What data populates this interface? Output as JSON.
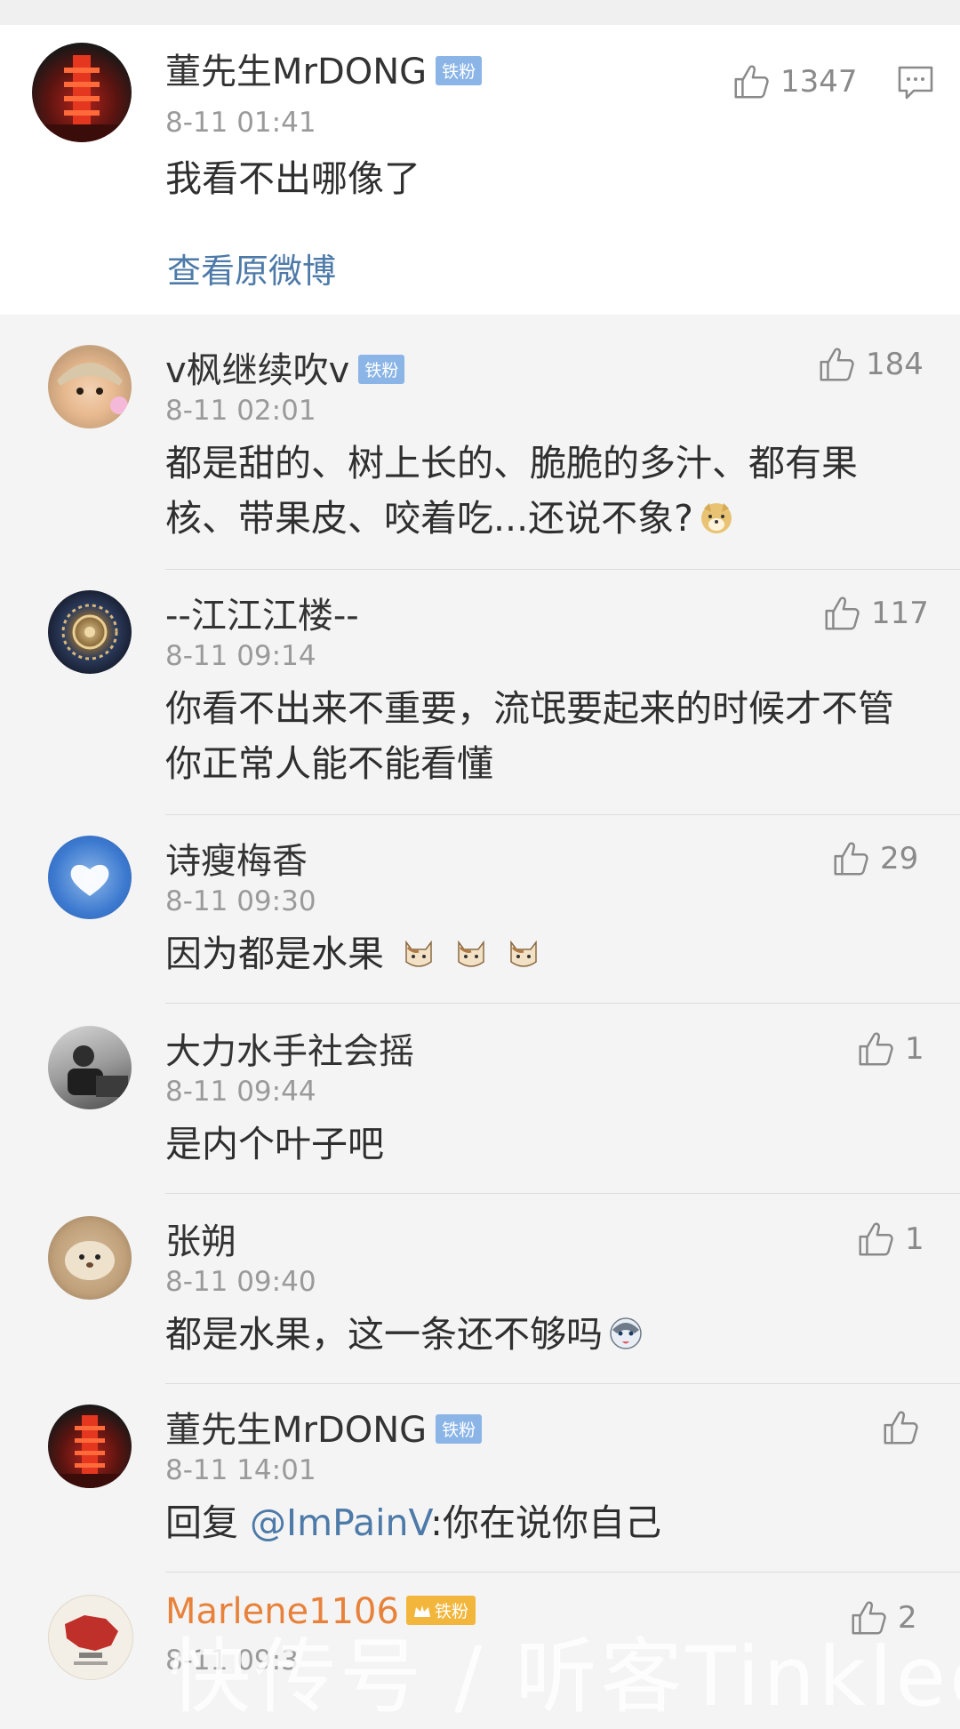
{
  "main_comment": {
    "user": "董先生MrDONG",
    "badge": "铁粉",
    "time": "8-11 01:41",
    "text": "我看不出哪像了",
    "likes": "1347",
    "view_original": "查看原微博"
  },
  "replies": [
    {
      "user": "v枫继续吹v",
      "badge": "铁粉",
      "time": "8-11 02:01",
      "text_line1": "都是甜的、树上长的、脆脆的多汁、都有果",
      "text_line2": "核、带果皮、咬着吃...还说不象?",
      "emoji": "doge-emoji",
      "likes": "184"
    },
    {
      "user": "--江江江楼--",
      "time": "8-11 09:14",
      "text_line1": "你看不出来不重要，流氓要起来的时候才不管",
      "text_line2": "你正常人能不能看懂",
      "likes": "117"
    },
    {
      "user": "诗瘦梅香",
      "time": "8-11 09:30",
      "text": "因为都是水果",
      "emoji": "cat-emoji",
      "likes": "29"
    },
    {
      "user": "大力水手社会摇",
      "time": "8-11 09:44",
      "text": "是内个叶子吧",
      "likes": "1"
    },
    {
      "user": "张朔",
      "time": "8-11 09:40",
      "text": "都是水果，这一条还不够吗",
      "emoji": "husky-emoji",
      "likes": "1"
    },
    {
      "user": "董先生MrDONG",
      "badge": "铁粉",
      "time": "8-11 14:01",
      "reply_prefix": "回复 ",
      "mention": "@ImPainV",
      "text": ":你在说你自己",
      "likes": ""
    },
    {
      "user": "Marlene1106",
      "badge": "铁粉",
      "time": "8-11 09:3",
      "likes": "2"
    }
  ],
  "watermark": "快传号 / 听客Tinkleo",
  "colors": {
    "link": "#4d7aa8",
    "badge": "#8bb5e6",
    "vip_name": "#e8823a",
    "background": "#f4f4f4"
  }
}
